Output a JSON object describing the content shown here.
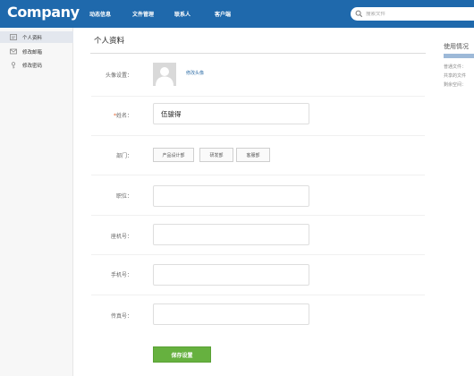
{
  "header": {
    "logo": "Company",
    "nav": [
      "动态信息",
      "文件管理",
      "联系人",
      "客户端"
    ],
    "search": {
      "placeholder": "搜索文件"
    }
  },
  "sidebar": {
    "items": [
      {
        "label": "个人资料",
        "icon": "id-card-icon",
        "active": true
      },
      {
        "label": "修改邮箱",
        "icon": "envelope-icon",
        "active": false
      },
      {
        "label": "修改密码",
        "icon": "key-icon",
        "active": false
      }
    ]
  },
  "main": {
    "title": "个人资料",
    "avatar": {
      "label": "头像设置：",
      "action": "修改头像"
    },
    "name": {
      "label": "姓名：",
      "required_mark": "*",
      "value": "伍骏得"
    },
    "department": {
      "label": "部门：",
      "options": [
        "产品设计部",
        "研发部",
        "客服部"
      ]
    },
    "position": {
      "label": "职位：",
      "value": ""
    },
    "landline": {
      "label": "座机号：",
      "value": ""
    },
    "mobile": {
      "label": "手机号：",
      "value": ""
    },
    "fax": {
      "label": "传真号：",
      "value": ""
    },
    "save_label": "保存设置"
  },
  "usage": {
    "title": "使用情况",
    "lines": [
      "普通文件：",
      "共享的文件",
      "剩余空间："
    ]
  },
  "colors": {
    "header_bg": "#1f69ac",
    "save_button": "#66b13f",
    "required": "#e4632d",
    "link": "#2f6ea7"
  }
}
